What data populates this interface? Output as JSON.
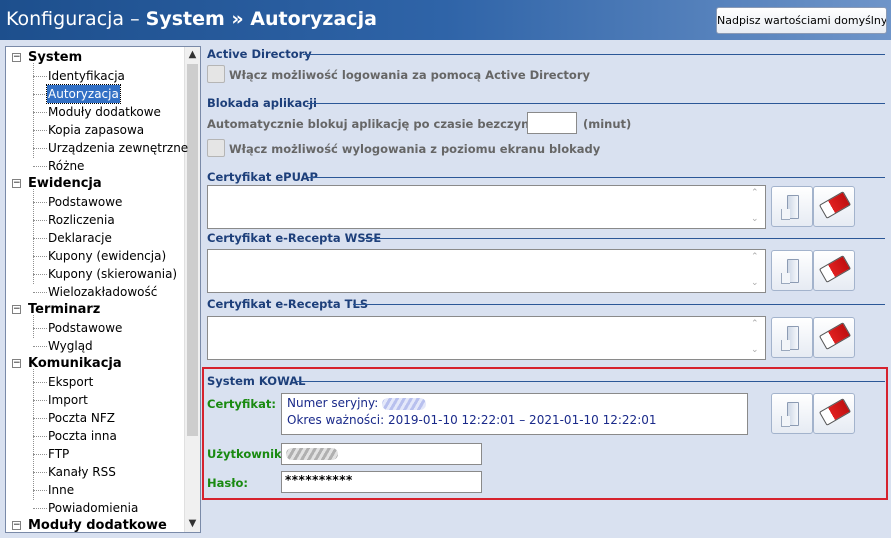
{
  "header": {
    "title_part1": "Konfiguracja – ",
    "title_part2": "System » Autoryzacja",
    "defaults_button": "Nadpisz wartościami domyślnymi"
  },
  "tree": {
    "categories": [
      {
        "label": "System",
        "expander": "−",
        "items": [
          "Identyfikacja",
          "Autoryzacja",
          "Moduły dodatkowe",
          "Kopia zapasowa",
          "Urządzenia zewnętrzne",
          "Różne"
        ]
      },
      {
        "label": "Ewidencja",
        "expander": "−",
        "items": [
          "Podstawowe",
          "Rozliczenia",
          "Deklaracje",
          "Kupony (ewidencja)",
          "Kupony (skierowania)",
          "Wielozakładowość"
        ]
      },
      {
        "label": "Terminarz",
        "expander": "−",
        "items": [
          "Podstawowe",
          "Wygląd"
        ]
      },
      {
        "label": "Komunikacja",
        "expander": "−",
        "items": [
          "Eksport",
          "Import",
          "Poczta NFZ",
          "Poczta inna",
          "FTP",
          "Kanały RSS",
          "Inne",
          "Powiadomienia"
        ]
      },
      {
        "label": "Moduły dodatkowe",
        "expander": "−",
        "items": []
      }
    ],
    "selected": "Autoryzacja",
    "scroll_up": "▲",
    "scroll_down": "▼"
  },
  "sections": {
    "active_directory": {
      "title": "Active Directory",
      "checkbox_label": "Włącz możliwość logowania za pomocą Active Directory"
    },
    "blokada": {
      "title": "Blokada aplikacji",
      "auto_lock_label": "Automatycznie blokuj aplikację po czasie bezczynności:",
      "auto_lock_value": "",
      "unit": "(minut)",
      "checkbox_label": "Włącz możliwość wylogowania z poziomu ekranu blokady"
    },
    "epuap": {
      "title": "Certyfikat ePUAP"
    },
    "wsse": {
      "title": "Certyfikat e-Recepta WSSE"
    },
    "tls": {
      "title": "Certyfikat e-Recepta TLS"
    },
    "kowal": {
      "title": "System KOWAL",
      "cert_label": "Certyfikat:",
      "serial_label": "Numer seryjny:",
      "validity_label": "Okres ważności:",
      "validity_value": "2019-01-10 12:22:01 – 2021-01-10 12:22:01",
      "user_label": "Użytkownik:",
      "password_label": "Hasło:",
      "password_value": "**********"
    }
  },
  "memo_scroll": {
    "up": "⌃",
    "down": "⌄"
  },
  "colors": {
    "header_start": "#1d4f8d",
    "header_end": "#6f95c9",
    "section_title": "#1d3f7a",
    "highlight_border": "#d6222e",
    "green_label": "#198a10",
    "tree_selected": "#3270c5"
  },
  "icons": {
    "load": "document-icon",
    "clear": "eraser-icon"
  }
}
